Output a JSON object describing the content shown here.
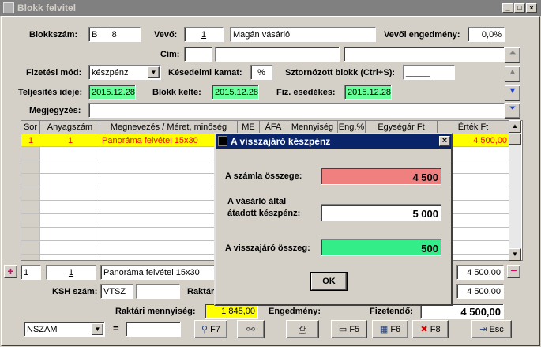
{
  "window": {
    "title": "Blokk felvitel",
    "min": "_",
    "max": "□",
    "close": "×"
  },
  "form": {
    "blokkszam_label": "Blokkszám:",
    "blokkszam_value": "B      8",
    "vevo_label": "Vevő:",
    "vevo_code": "1",
    "vevo_name": "Magán vásárló",
    "engedmeny_label": "Vevői engedmény:",
    "engedmeny_value": "0,0%",
    "cim_label": "Cím:",
    "cim1": "",
    "cim2": "",
    "cim3": "",
    "fizmod_label": "Fizetési mód:",
    "fizmod_value": "készpénz",
    "kesedelmi_label": "Késedelmi kamat:",
    "kesedelmi_value": "%",
    "sztorno_label": "Sztornózott blokk (Ctrl+S):",
    "sztorno_value": "_____",
    "teljesites_label": "Teljesítés ideje:",
    "teljesites_value": "2015.12.28",
    "kelte_label": "Blokk kelte:",
    "kelte_value": "2015.12.28",
    "esedekes_label": "Fiz. esedékes:",
    "esedekes_value": "2015.12.28",
    "megjegyzes_label": "Megjegyzés:",
    "megjegyzes_value": ""
  },
  "grid": {
    "columns": [
      "Sor",
      "Anyagszám",
      "Megnevezés / Méret, minőség",
      "ME",
      "ÁFA",
      "Mennyiség",
      "Eng.%",
      "Egységár Ft",
      "Érték Ft"
    ],
    "rows": [
      {
        "sor": "1",
        "anyagszam": "1",
        "megnevezes": "Panoráma felvétel 15x30",
        "ertek": "4 500,00"
      }
    ]
  },
  "edit_row": {
    "sor": "1",
    "anyagszam": "1",
    "megnevezes": "Panoráma felvétel 15x30",
    "ertek": "4 500,00"
  },
  "bottom": {
    "ksh_label": "KSH szám:",
    "ksh_value": "VTSZ",
    "raktar_label": "Raktár",
    "raktari_menny_label": "Raktári mennyiség:",
    "raktari_menny_value": "1 845,00",
    "engedmeny_label": "Engedmény:",
    "fizetendo_label": "Fizetendő:",
    "fizetendo_value": "4 500,00",
    "ertek_value": "4 500,00",
    "search_select": "NSZAM",
    "equals": "="
  },
  "toolbar": {
    "f7": "F7",
    "f5": "F5",
    "f6": "F6",
    "f8": "F8",
    "esc": "Esc"
  },
  "dialog": {
    "title": "A visszajáró készpénz",
    "osszeg_label": "A számla összege:",
    "osszeg_value": "4 500",
    "atadott_label_1": "A vásárló által",
    "atadott_label_2": "átadott készpénz:",
    "atadott_value": "5 000",
    "visszajaro_label": "A visszajáró összeg:",
    "visszajaro_value": "500",
    "ok": "OK"
  },
  "colors": {
    "highlight_green": "#66ff99",
    "highlight_red": "#f08080",
    "selected_row": "#ffff00",
    "dialog_title": "#0a246a"
  }
}
